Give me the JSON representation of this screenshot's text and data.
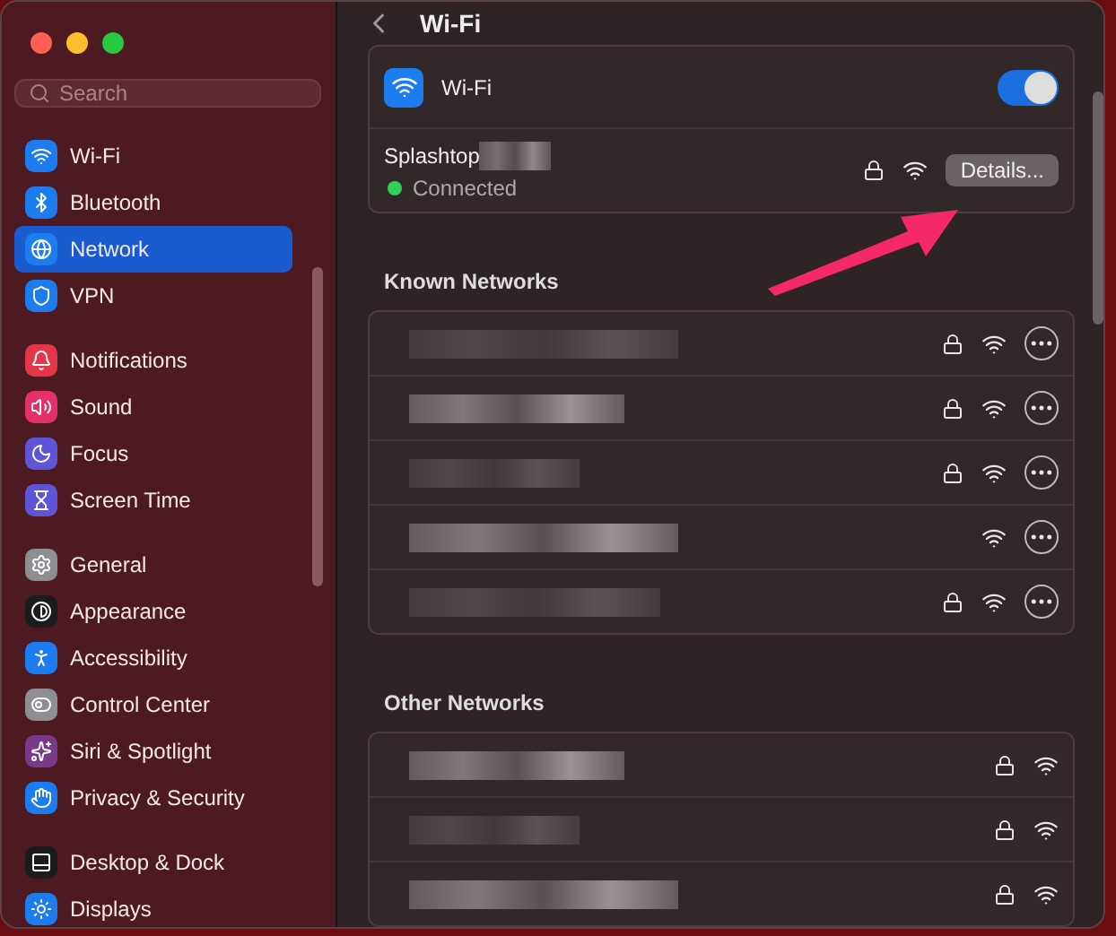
{
  "sidebar": {
    "search": {
      "placeholder": "Search"
    },
    "groups": [
      [
        {
          "label": "Wi-Fi",
          "kind": "wifi",
          "color": "#1c7cf0",
          "selected": false
        },
        {
          "label": "Bluetooth",
          "kind": "bluetooth",
          "color": "#1c7cf0",
          "selected": false
        },
        {
          "label": "Network",
          "kind": "globe",
          "color": "#1c7cf0",
          "selected": true
        },
        {
          "label": "VPN",
          "kind": "vpn",
          "color": "#1c7cf0",
          "selected": false
        }
      ],
      [
        {
          "label": "Notifications",
          "kind": "bell",
          "color": "#e5364a",
          "selected": false
        },
        {
          "label": "Sound",
          "kind": "sound",
          "color": "#e5306a",
          "selected": false
        },
        {
          "label": "Focus",
          "kind": "moon",
          "color": "#5e55d8",
          "selected": false
        },
        {
          "label": "Screen Time",
          "kind": "hourglass",
          "color": "#5e55d8",
          "selected": false
        }
      ],
      [
        {
          "label": "General",
          "kind": "gear",
          "color": "#8e8e93",
          "selected": false
        },
        {
          "label": "Appearance",
          "kind": "appearance",
          "color": "#1c1c1e",
          "selected": false
        },
        {
          "label": "Accessibility",
          "kind": "accessibility",
          "color": "#1c7cf0",
          "selected": false
        },
        {
          "label": "Control Center",
          "kind": "toggles",
          "color": "#8e8e93",
          "selected": false
        },
        {
          "label": "Siri & Spotlight",
          "kind": "siri",
          "color": "#7a3a8a",
          "selected": false
        },
        {
          "label": "Privacy & Security",
          "kind": "hand",
          "color": "#1c7cf0",
          "selected": false
        }
      ],
      [
        {
          "label": "Desktop & Dock",
          "kind": "dock",
          "color": "#1c1c1e",
          "selected": false
        },
        {
          "label": "Displays",
          "kind": "sun",
          "color": "#1c7cf0",
          "selected": false
        }
      ]
    ]
  },
  "header": {
    "title": "Wi-Fi"
  },
  "wifi_card": {
    "label": "Wi-Fi",
    "on": true,
    "network": "Splashtop",
    "status": {
      "text": "Connected",
      "color": "#30d158"
    },
    "locked": true,
    "button": "Details..."
  },
  "known_networks": {
    "title": "Known Networks",
    "rows": [
      {
        "locked": true
      },
      {
        "locked": true
      },
      {
        "locked": true
      },
      {
        "locked": false
      },
      {
        "locked": true
      }
    ]
  },
  "other_networks": {
    "title": "Other Networks",
    "rows": [
      {
        "locked": true
      },
      {
        "locked": true
      },
      {
        "locked": true
      }
    ]
  }
}
